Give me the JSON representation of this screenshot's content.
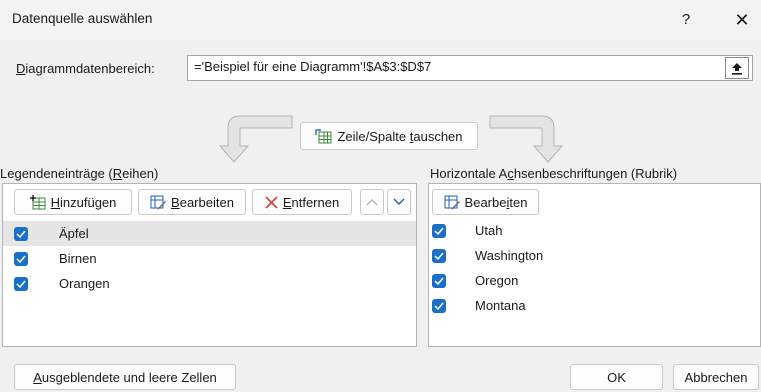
{
  "window": {
    "title": "Datenquelle auswählen",
    "help": "?",
    "close": "✕"
  },
  "range": {
    "label_accel": "D",
    "label_rest": "iagrammdatenbereich:",
    "value": "='Beispiel für eine Diagramm'!$A$3:$D$7"
  },
  "switch": {
    "pre": "Zeile/Spalte ",
    "accel": "t",
    "post": "auschen"
  },
  "legend": {
    "label_pre": "Legendeneinträge (",
    "label_accel": "R",
    "label_post": "eihen)",
    "add_accel": "H",
    "add_rest": "inzufügen",
    "edit_accel": "B",
    "edit_rest": "earbeiten",
    "remove_accel": "E",
    "remove_rest": "ntfernen",
    "items": [
      {
        "label": "Äpfel",
        "checked": true,
        "selected": true
      },
      {
        "label": "Birnen",
        "checked": true,
        "selected": false
      },
      {
        "label": "Orangen",
        "checked": true,
        "selected": false
      }
    ]
  },
  "axis": {
    "label_pre": "Horizontale A",
    "label_accel": "c",
    "label_post": "hsenbeschriftungen (Rubrik)",
    "edit_pre": "Bearbe",
    "edit_accel": "i",
    "edit_post": "ten",
    "items": [
      {
        "label": "Utah",
        "checked": true
      },
      {
        "label": "Washington",
        "checked": true
      },
      {
        "label": "Oregon",
        "checked": true
      },
      {
        "label": "Montana",
        "checked": true
      }
    ]
  },
  "footer": {
    "hidden_accel": "A",
    "hidden_rest": "usgeblendete und leere Zellen",
    "ok": "OK",
    "cancel": "Abbrechen"
  },
  "colors": {
    "checkbox": "#1a6fc8",
    "selected_row": "#e5e5e5",
    "remove_icon": "#d94040"
  }
}
